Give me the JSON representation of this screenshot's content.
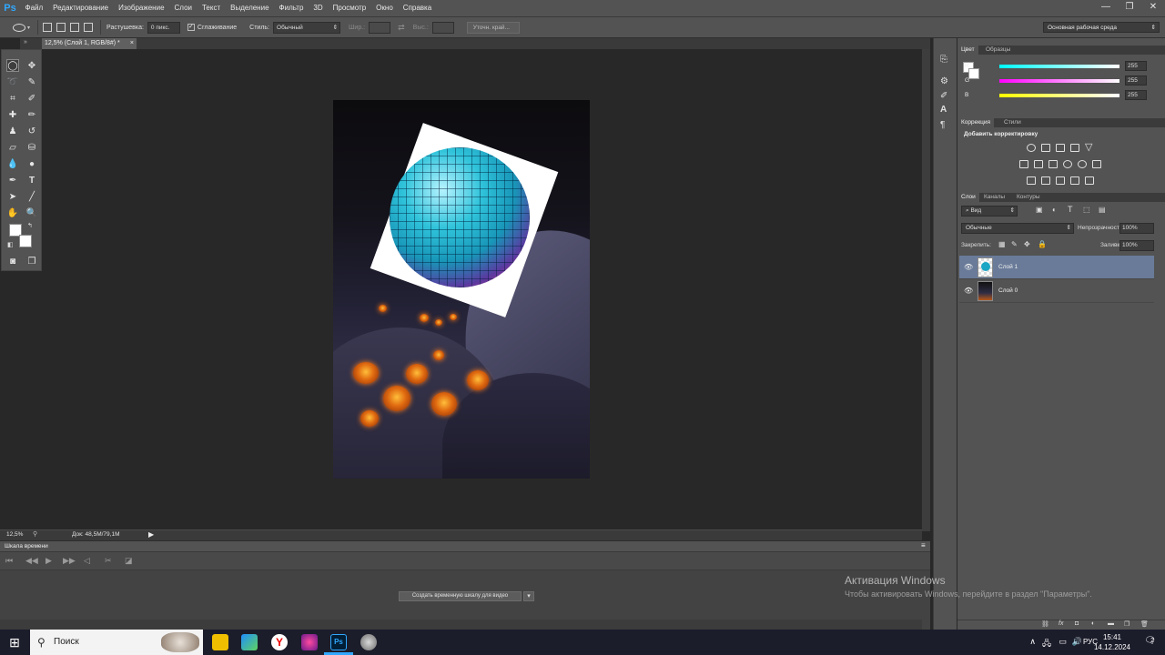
{
  "app": {
    "logo": "Ps"
  },
  "menu": [
    "Файл",
    "Редактирование",
    "Изображение",
    "Слои",
    "Текст",
    "Выделение",
    "Фильтр",
    "3D",
    "Просмотр",
    "Окно",
    "Справка"
  ],
  "window_controls": {
    "minimize": "—",
    "restore": "❐",
    "close": "✕"
  },
  "options_bar": {
    "feather_label": "Растушевка:",
    "feather_value": "0 пикс.",
    "antialias_label": "Сглаживание",
    "antialias_checked": true,
    "style_label": "Стиль:",
    "style_value": "Обычный",
    "width_label": "Шир.:",
    "height_label": "Выс.:",
    "refine_edge": "Уточн. край...",
    "workspace": "Основная рабочая среда"
  },
  "document_tab": {
    "title": "12,5% (Слой 1, RGB/8#) *",
    "close": "×"
  },
  "status": {
    "zoom": "12,5%",
    "doc": "Док: 48,5M/79,1M"
  },
  "timeline": {
    "title": "Шкала времени",
    "create_button": "Создать временную шкалу для видео"
  },
  "color_panel": {
    "tabs": [
      "Цвет",
      "Образцы"
    ],
    "channels": [
      {
        "label": "R",
        "value": "255",
        "gradient": "linear-gradient(90deg,#00ffff,#ffffff)"
      },
      {
        "label": "G",
        "value": "255",
        "gradient": "linear-gradient(90deg,#ff00ff,#ffffff)"
      },
      {
        "label": "B",
        "value": "255",
        "gradient": "linear-gradient(90deg,#ffff00,#ffffff)"
      }
    ]
  },
  "adjustments_panel": {
    "tabs": [
      "Коррекция",
      "Стили"
    ],
    "title": "Добавить корректировку"
  },
  "layers_panel": {
    "tabs": [
      "Слои",
      "Каналы",
      "Контуры"
    ],
    "filter": "Вид",
    "blend_mode": "Обычные",
    "opacity_label": "Непрозрачность:",
    "opacity_value": "100%",
    "lock_label": "Закрепить:",
    "fill_label": "Заливка:",
    "fill_value": "100%",
    "layers": [
      {
        "name": "Слой 1",
        "selected": true
      },
      {
        "name": "Слой 0",
        "selected": false
      }
    ]
  },
  "activation": {
    "title": "Активация Windows",
    "text": "Чтобы активировать Windows, перейдите в раздел \"Параметры\"."
  },
  "taskbar": {
    "search": "Поиск",
    "lang": "РУС",
    "time": "15:41",
    "date": "14.12.2024",
    "notifications": "2"
  },
  "colors": {
    "accent": "#31a8ff",
    "selected_layer": "#6a7b99",
    "panel": "#535353"
  }
}
